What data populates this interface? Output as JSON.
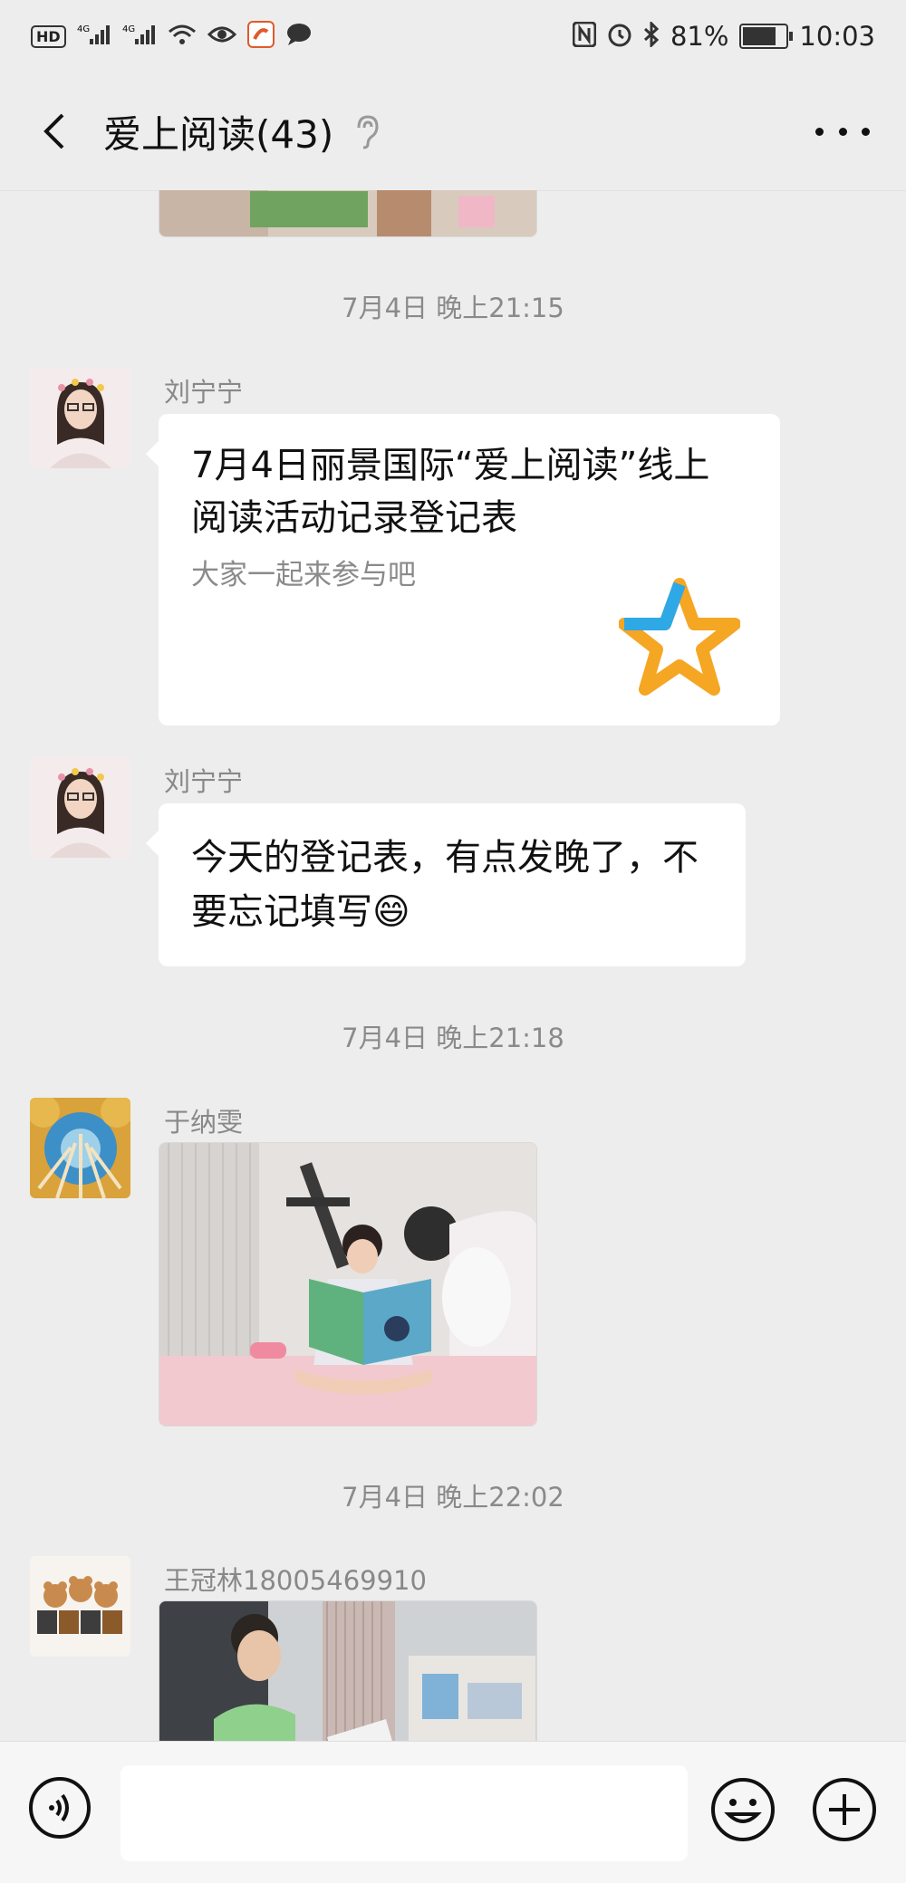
{
  "status_bar": {
    "hd_label": "HD",
    "signal_label_1": "4G",
    "signal_label_2": "4G",
    "battery_text": "81%",
    "time": "10:03",
    "battery_level": 0.81
  },
  "header": {
    "title": "爱上阅读(43)"
  },
  "messages": [
    {
      "type": "timestamp",
      "text": "7月4日 晚上21:15"
    },
    {
      "type": "card",
      "sender": "刘宁宁",
      "title": "7月4日丽景国际“爱上阅读”线上阅读活动记录登记表",
      "subtitle": "大家一起来参与吧"
    },
    {
      "type": "text",
      "sender": "刘宁宁",
      "text": "今天的登记表，有点发晚了，不要忘记填写😄"
    },
    {
      "type": "timestamp",
      "text": "7月4日 晚上21:18"
    },
    {
      "type": "image",
      "sender": "于纳雯"
    },
    {
      "type": "timestamp",
      "text": "7月4日 晚上22:02"
    },
    {
      "type": "image",
      "sender": "王冠林18005469910"
    }
  ],
  "colors": {
    "background": "#ededed",
    "bubble": "#ffffff",
    "star_orange": "#f5a623",
    "star_blue": "#2fa8e6"
  }
}
